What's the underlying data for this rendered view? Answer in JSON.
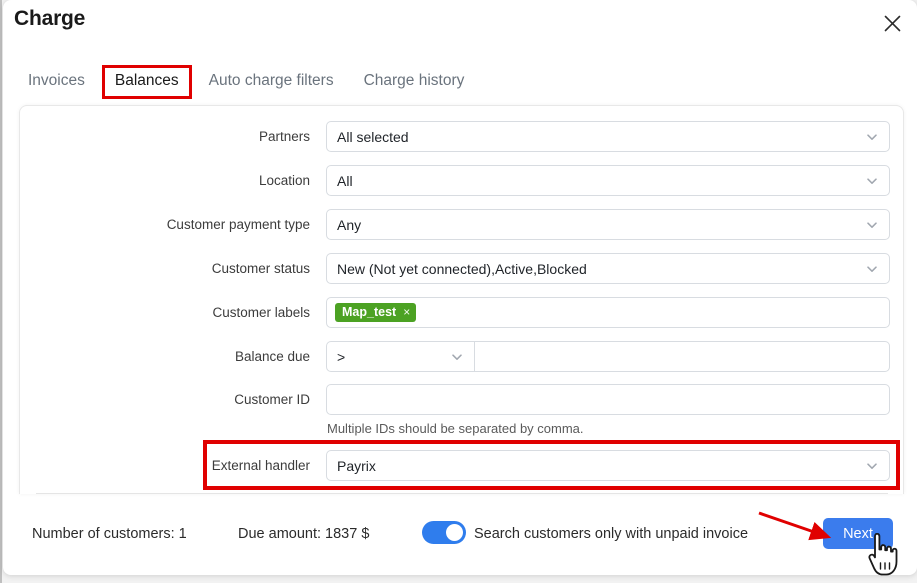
{
  "window": {
    "title": "Charge",
    "close_icon": "close-icon"
  },
  "tabs": [
    {
      "label": "Invoices",
      "active": false,
      "highlighted": false
    },
    {
      "label": "Balances",
      "active": true,
      "highlighted": true
    },
    {
      "label": "Auto charge filters",
      "active": false,
      "highlighted": false
    },
    {
      "label": "Charge history",
      "active": false,
      "highlighted": false
    }
  ],
  "form": {
    "partners": {
      "label": "Partners",
      "value": "All selected",
      "icon": "chevron-down-icon"
    },
    "location": {
      "label": "Location",
      "value": "All",
      "icon": "chevron-down-icon"
    },
    "customer_payment_type": {
      "label": "Customer payment type",
      "value": "Any",
      "icon": "chevron-down-icon"
    },
    "customer_status": {
      "label": "Customer status",
      "value": "New (Not yet connected),Active,Blocked",
      "icon": "chevron-down-icon"
    },
    "customer_labels": {
      "label": "Customer labels",
      "tags": [
        {
          "text": "Map_test",
          "remove": "×",
          "color": "#4ca223"
        }
      ]
    },
    "balance_due": {
      "label": "Balance due",
      "operator": ">",
      "value": "",
      "icon": "chevron-down-icon"
    },
    "customer_id": {
      "label": "Customer ID",
      "value": "",
      "helper": "Multiple IDs should be separated by comma."
    },
    "external_handler": {
      "label": "External handler",
      "value": "Payrix",
      "icon": "chevron-down-icon",
      "highlighted": true
    }
  },
  "footer": {
    "number_of_customers": "Number of customers: 1",
    "due_amount": "Due amount: 1837 $",
    "toggle_label": "Search customers only with unpaid invoice",
    "toggle_on": true,
    "next_label": "Next"
  },
  "annotations": {
    "highlight_color": "#e00000",
    "accent_color": "#3b7ced",
    "arrow": "red-arrow-annotation",
    "cursor": "hand-cursor-annotation"
  }
}
